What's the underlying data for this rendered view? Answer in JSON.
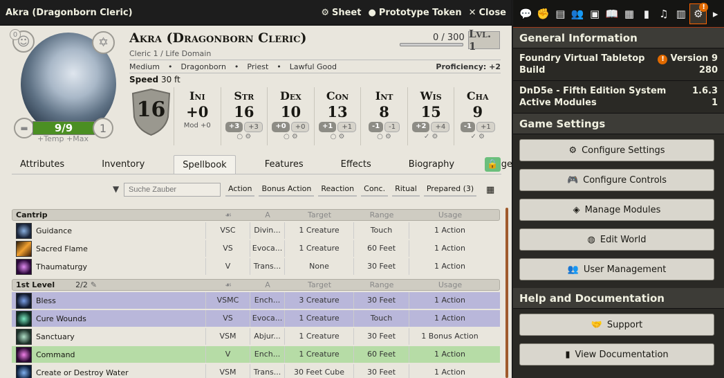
{
  "window": {
    "title": "Akra (Dragonborn Cleric)",
    "sheet_label": "Sheet",
    "token_label": "Prototype Token",
    "close_label": "Close"
  },
  "character": {
    "name": "Akra (Dragonborn Cleric)",
    "class_line": "Cleric 1 / Life Domain",
    "xp": "0 / 300",
    "level": "Lvl. 1",
    "size": "Medium",
    "race": "Dragonborn",
    "background": "Priest",
    "alignment": "Lawful Good",
    "proficiency": "Proficiency: +2",
    "speed_label": "Speed",
    "speed_value": "30 ft",
    "ac": "16",
    "hp": "9/9",
    "hp_temp": "+Temp",
    "hp_max": "+Max",
    "hit_dice": "1",
    "inspiration": "0",
    "initiative": {
      "label": "Ini",
      "value": "+0",
      "sub": "Mod +0"
    },
    "abilities": [
      {
        "label": "Str",
        "value": "16",
        "mod": "+3",
        "save": "+3"
      },
      {
        "label": "Dex",
        "value": "10",
        "mod": "+0",
        "save": "+0"
      },
      {
        "label": "Con",
        "value": "13",
        "mod": "+1",
        "save": "+1"
      },
      {
        "label": "Int",
        "value": "8",
        "mod": "-1",
        "save": "-1"
      },
      {
        "label": "Wis",
        "value": "15",
        "mod": "+2",
        "save": "+4"
      },
      {
        "label": "Cha",
        "value": "9",
        "mod": "-1",
        "save": "+1"
      }
    ]
  },
  "tabs": [
    "Attributes",
    "Inventory",
    "Spellbook",
    "Features",
    "Effects",
    "Biography",
    "Tagebuch"
  ],
  "active_tab": "Spellbook",
  "spellbook": {
    "search_placeholder": "Suche Zauber",
    "filters": [
      "Action",
      "Bonus Action",
      "Reaction",
      "Conc.",
      "Ritual",
      "Prepared (3)"
    ],
    "columns": {
      "target": "Target",
      "range": "Range",
      "usage": "Usage"
    },
    "cantrip_header": "Cantrip",
    "level1_header": "1st Level",
    "level1_slots": "2/2",
    "cantrips": [
      {
        "name": "Guidance",
        "comp": "VSC",
        "school": "Divin...",
        "target": "1 Creature",
        "range": "Touch",
        "usage": "1 Action"
      },
      {
        "name": "Sacred Flame",
        "comp": "VS",
        "school": "Evoca...",
        "target": "1 Creature",
        "range": "60 Feet",
        "usage": "1 Action"
      },
      {
        "name": "Thaumaturgy",
        "comp": "V",
        "school": "Trans...",
        "target": "None",
        "range": "30 Feet",
        "usage": "1 Action"
      }
    ],
    "level1": [
      {
        "name": "Bless",
        "comp": "VSMC",
        "school": "Ench...",
        "target": "3 Creature",
        "range": "30 Feet",
        "usage": "1 Action"
      },
      {
        "name": "Cure Wounds",
        "comp": "VS",
        "school": "Evoca...",
        "target": "1 Creature",
        "range": "Touch",
        "usage": "1 Action"
      },
      {
        "name": "Sanctuary",
        "comp": "VSM",
        "school": "Abjur...",
        "target": "1 Creature",
        "range": "30 Feet",
        "usage": "1 Bonus Action"
      },
      {
        "name": "Command",
        "comp": "V",
        "school": "Ench...",
        "target": "1 Creature",
        "range": "60 Feet",
        "usage": "1 Action"
      },
      {
        "name": "Create or Destroy Water",
        "comp": "VSM",
        "school": "Trans...",
        "target": "30 Feet Cube",
        "range": "30 Feet",
        "usage": "1 Action"
      }
    ]
  },
  "sidebar": {
    "general_header": "General Information",
    "foundry_label": "Foundry Virtual Tabletop",
    "foundry_version": "Version 9",
    "build_label": "Build",
    "build_value": "280",
    "system_label": "DnD5e - Fifth Edition System",
    "system_version": "1.6.3",
    "modules_label": "Active Modules",
    "modules_value": "1",
    "game_settings_header": "Game Settings",
    "buttons": [
      "Configure Settings",
      "Configure Controls",
      "Manage Modules",
      "Edit World",
      "User Management"
    ],
    "help_header": "Help and Documentation",
    "help_buttons": [
      "Support",
      "View Documentation"
    ]
  },
  "colors": {
    "accent": "#ff6400",
    "hp_green": "#4b8f23",
    "warn": "#e16a00"
  }
}
